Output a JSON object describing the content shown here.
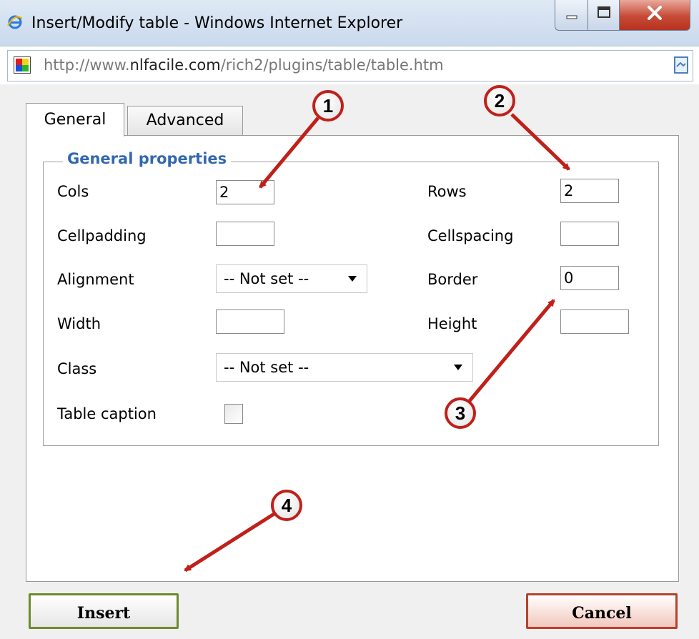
{
  "window": {
    "title": "Insert/Modify table - Windows Internet Explorer",
    "url_prefix": "http://www.",
    "url_domain": "nlfacile.com",
    "url_path": "/rich2/plugins/table/table.htm"
  },
  "tabs": {
    "general": "General",
    "advanced": "Advanced"
  },
  "fieldset": {
    "legend": "General properties"
  },
  "fields": {
    "cols_label": "Cols",
    "cols_value": "2",
    "rows_label": "Rows",
    "rows_value": "2",
    "cellpadding_label": "Cellpadding",
    "cellpadding_value": "",
    "cellspacing_label": "Cellspacing",
    "cellspacing_value": "",
    "alignment_label": "Alignment",
    "alignment_value": "-- Not set --",
    "border_label": "Border",
    "border_value": "0",
    "width_label": "Width",
    "width_value": "",
    "height_label": "Height",
    "height_value": "",
    "class_label": "Class",
    "class_value": "-- Not set --",
    "caption_label": "Table caption",
    "caption_checked": false
  },
  "buttons": {
    "insert": "Insert",
    "cancel": "Cancel"
  },
  "callouts": [
    "1",
    "2",
    "3",
    "4"
  ],
  "colors": {
    "arrow": "#c0201a",
    "legend": "#3368b0",
    "insert_border": "#6d8b2c",
    "cancel_border": "#b7412d"
  }
}
